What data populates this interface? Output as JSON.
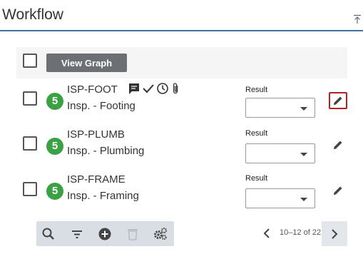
{
  "header": {
    "title": "Workflow",
    "collapse_icon": "collapse-top-icon"
  },
  "toolbar": {
    "view_graph_label": "View Graph"
  },
  "rows": [
    {
      "count": "5",
      "code": "ISP-FOOT",
      "desc": "Insp. - Footing",
      "result_label": "Result",
      "result_value": "",
      "status_icons": [
        "comment-icon",
        "check-icon",
        "clock-icon",
        "attachment-icon"
      ]
    },
    {
      "count": "5",
      "code": "ISP-PLUMB",
      "desc": "Insp. - Plumbing",
      "result_label": "Result",
      "result_value": ""
    },
    {
      "count": "5",
      "code": "ISP-FRAME",
      "desc": "Insp. - Framing",
      "result_label": "Result",
      "result_value": ""
    }
  ],
  "bottom_toolbar": {
    "icons": [
      "search-icon",
      "filter-icon",
      "add-circle-icon",
      "delete-icon",
      "settings-icon"
    ]
  },
  "pager": {
    "text": "10–12 of 22"
  },
  "colors": {
    "accent_border": "#3f6fa0",
    "badge_green": "#3aa145",
    "focus_red": "#b22222",
    "button_gray": "#6c6f74"
  }
}
